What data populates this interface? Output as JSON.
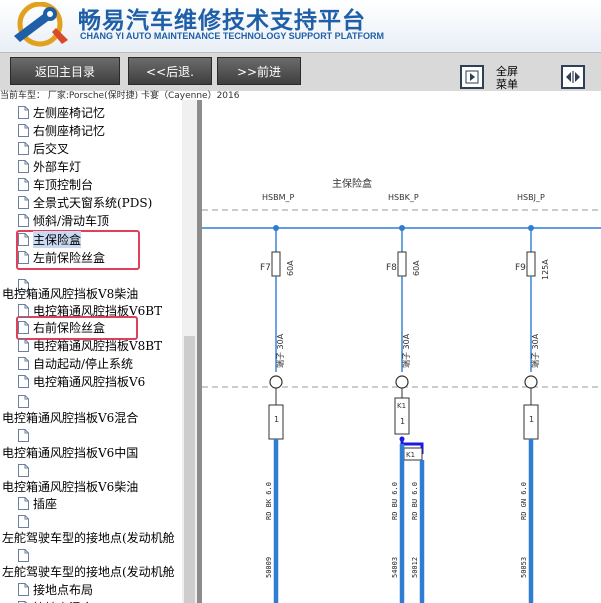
{
  "header": {
    "title_cn": "畅易汽车维修技术支持平台",
    "title_en": "CHANG YI AUTO MAINTENANCE TECHNOLOGY SUPPORT PLATFORM",
    "logo_icon": "wrench-gear-logo-icon"
  },
  "toolbar": {
    "home_label": "返回主目录",
    "back_label": "<<后退.",
    "forward_label": ">>前进",
    "fullscreen_label_1": "全屏",
    "fullscreen_label_2": "菜单"
  },
  "info": "当前车型：  厂家:Porsche(保时捷) 卡宴（Cayenne）2016",
  "tree": [
    {
      "label": "左侧座椅记忆"
    },
    {
      "label": "右侧座椅记忆"
    },
    {
      "label": "后交叉"
    },
    {
      "label": "外部车灯"
    },
    {
      "label": "车顶控制台"
    },
    {
      "label": "全景式天窗系统(PDS)"
    },
    {
      "label": "倾斜/滑动车顶"
    },
    {
      "label": "主保险盒"
    },
    {
      "label": "左前保险丝盒"
    },
    {
      "label": ""
    },
    {
      "label": "电控箱通风腔挡板V8柴油"
    },
    {
      "label": "电控箱通风腔挡板V6BT"
    },
    {
      "label": "右前保险丝盒"
    },
    {
      "label": "电控箱通风腔挡板V8BT"
    },
    {
      "label": "自动起动/停止系统"
    },
    {
      "label": "电控箱通风腔挡板V6"
    },
    {
      "label": ""
    },
    {
      "label": "电控箱通风腔挡板V6混合"
    },
    {
      "label": ""
    },
    {
      "label": "电控箱通风腔挡板V6中国"
    },
    {
      "label": ""
    },
    {
      "label": "电控箱通风腔挡板V6柴油"
    },
    {
      "label": "插座"
    },
    {
      "label": ""
    },
    {
      "label": "左舵驾驶车型的接地点(发动机舱"
    },
    {
      "label": ""
    },
    {
      "label": "左舵驾驶车型的接地点(发动机舱"
    },
    {
      "label": "接地点布局"
    },
    {
      "label": "接地点混合"
    }
  ],
  "diagram": {
    "main_label": "主保险盒",
    "columns": [
      {
        "wire_top": "HSBM_P",
        "fuse": "F7",
        "amp": "60A",
        "conn": "端子 30A",
        "pin": "1",
        "wire_code": "RD BK 6.0",
        "wire_bottom": "50009"
      },
      {
        "wire_top": "HSBK_P",
        "fuse": "F8",
        "amp": "60A",
        "conn": "端子 30A",
        "pin": "1",
        "relay": "K1",
        "relay_box": "K1",
        "wire_code": "RD BU 6.0",
        "wire_code_2": "RD BU 6.0",
        "wire_bottom": "54003",
        "wire_bottom_2": "50012"
      },
      {
        "wire_top": "HSBJ_P",
        "fuse": "F9",
        "amp": "125A",
        "conn": "端子 30A",
        "pin": "1",
        "wire_code": "RD GN 6.0",
        "wire_bottom": "50053"
      }
    ]
  },
  "colors": {
    "brand": "#1f5fa8",
    "wire": "#2e7dd1",
    "highlight": "#e0405a",
    "selected_bg": "#c9d9f2"
  }
}
